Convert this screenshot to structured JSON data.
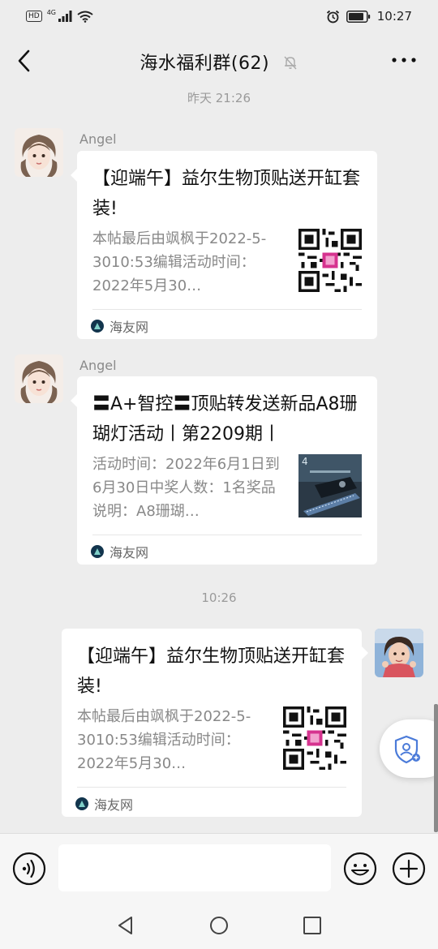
{
  "status_bar": {
    "network": "4G",
    "hd": "HD",
    "time": "10:27"
  },
  "header": {
    "title": "海水福利群(62)"
  },
  "messages": [
    {
      "time": "昨天 21:26",
      "sender": "Angel",
      "title": "【迎端午】益尔生物顶贴送开缸套装!",
      "desc": "本帖最后由飒枫于2022-5-3010:53编辑活动时间：2022年5月30…",
      "source": "海友网",
      "thumb": "qr-code"
    },
    {
      "sender": "Angel",
      "title": "〓A+智控〓顶贴转发送新品A8珊 瑚灯活动丨第2209期丨",
      "desc": "活动时间：2022年6月1日到6月30日中奖人数：1名奖品说明：A8珊瑚…",
      "source": "海友网",
      "thumb": "product-photo"
    },
    {
      "time": "10:26",
      "title": "【迎端午】益尔生物顶贴送开缸套装!",
      "desc": "本帖最后由飒枫于2022-5-3010:53编辑活动时间：2022年5月30…",
      "source": "海友网",
      "thumb": "qr-code"
    }
  ],
  "input": {
    "value": ""
  },
  "colors": {
    "background": "#ededed",
    "card": "#ffffff",
    "text_primary": "#111111",
    "text_secondary": "#888888",
    "source_icon": "#12354d",
    "qr_accent": "#d6338f",
    "shield_icon": "#4b7bd9"
  }
}
